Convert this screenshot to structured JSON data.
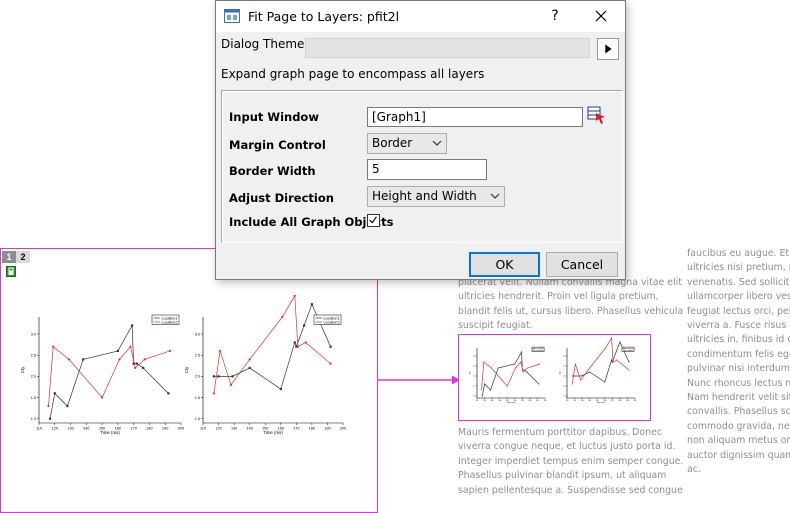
{
  "dialog": {
    "title": "Fit Page to Layers: pfit2l",
    "help_label": "?",
    "theme_label": "Dialog Theme",
    "theme_value": "",
    "description": "Expand graph page to encompass all layers",
    "input_window_label": "Input Window",
    "input_window_value": "[Graph1]",
    "margin_control_label": "Margin Control",
    "margin_control_value": "Border",
    "border_width_label": "Border Width",
    "border_width_value": "5",
    "adjust_direction_label": "Adjust Direction",
    "adjust_direction_value": "Height and Width",
    "include_all_label": "Include All Graph Objects",
    "include_all_checked": true,
    "ok_label": "OK",
    "cancel_label": "Cancel"
  },
  "graph_window": {
    "layer_tabs": [
      "1",
      "2"
    ]
  },
  "chart_data": [
    {
      "type": "line",
      "xlabel": "Time (ms)",
      "ylabel": "Cty",
      "xlim": [
        110,
        200
      ],
      "ylim": [
        0.9,
        3.4
      ],
      "xticks": [
        "110",
        "120",
        "130",
        "140",
        "150",
        "160",
        "170",
        "180",
        "190",
        "200"
      ],
      "yticks": [
        "1.0",
        "1.5",
        "2.0",
        "2.5",
        "3.0"
      ],
      "series": [
        {
          "name": "Location1",
          "color": "#333333",
          "x": [
            117,
            120,
            128,
            138,
            160,
            169,
            170,
            172,
            176,
            192
          ],
          "y": [
            1.0,
            1.6,
            1.3,
            2.4,
            2.6,
            3.2,
            2.3,
            2.3,
            2.2,
            1.6
          ]
        },
        {
          "name": "Location2",
          "color": "#e03030",
          "x": [
            116,
            119,
            129,
            150,
            161,
            168,
            171,
            177,
            193
          ],
          "y": [
            1.3,
            2.7,
            2.4,
            1.5,
            2.4,
            2.7,
            2.2,
            2.4,
            2.6
          ]
        }
      ]
    },
    {
      "type": "line",
      "xlabel": "Time (ms)",
      "ylabel": "Cty",
      "xlim": [
        110,
        200
      ],
      "ylim": [
        0.9,
        3.4
      ],
      "xticks": [
        "110",
        "120",
        "130",
        "140",
        "150",
        "160",
        "170",
        "180",
        "190",
        "200"
      ],
      "yticks": [
        "1.0",
        "1.5",
        "2.0",
        "2.5",
        "3.0"
      ],
      "series": [
        {
          "name": "Location1",
          "color": "#333333",
          "x": [
            117,
            120,
            129,
            140,
            160,
            169,
            170,
            175,
            180,
            192
          ],
          "y": [
            2.0,
            2.0,
            2.0,
            2.2,
            1.7,
            2.8,
            2.7,
            3.2,
            3.7,
            2.7
          ]
        },
        {
          "name": "Location2",
          "color": "#e03030",
          "x": [
            117,
            121,
            128,
            140,
            161,
            169,
            171,
            176,
            192
          ],
          "y": [
            1.6,
            2.6,
            1.8,
            2.4,
            3.4,
            3.9,
            2.7,
            2.8,
            2.3
          ]
        }
      ]
    }
  ],
  "background_text": {
    "middle_top": [
      "placerat velit. Nullam convallis magna vitae elit",
      "ultricies hendrerit. Proin vel ligula pretium,",
      "blandit felis ut, cursus libero. Phasellus vehicula",
      "suscipit feugiat."
    ],
    "middle_bottom": [
      "Mauris fermentum porttitor dapibus. Donec",
      "viverra congue neque, et luctus justo porta id.",
      "Integer imperdiet tempus enim semper congue.",
      "Phasellus pulvinar blandit ipsum, ut aliquam",
      "sapien pellentesque a. Suspendisse sed congue"
    ],
    "right": [
      "faucibus eu augue. Etiam",
      "ultricies nisi pretium, nec",
      "venenatis. Sed sollicitudin",
      "ullamcorper libero vestibulum",
      "feugiat lectus orci, pellentesque",
      "viverra a. Fusce risus massa,",
      "ultricies in, finibus id quam.",
      "condimentum felis eget ultricies",
      "pulvinar nisi interdum. Aliquam",
      "Nunc rhoncus lectus nulla, ut",
      "Nam hendrerit velit sit amet",
      "convallis. Phasellus scelerisque",
      "commodo gravida, neque",
      "non aliquam metus orci in",
      "auctor dignissim quam, non",
      "ac."
    ]
  }
}
